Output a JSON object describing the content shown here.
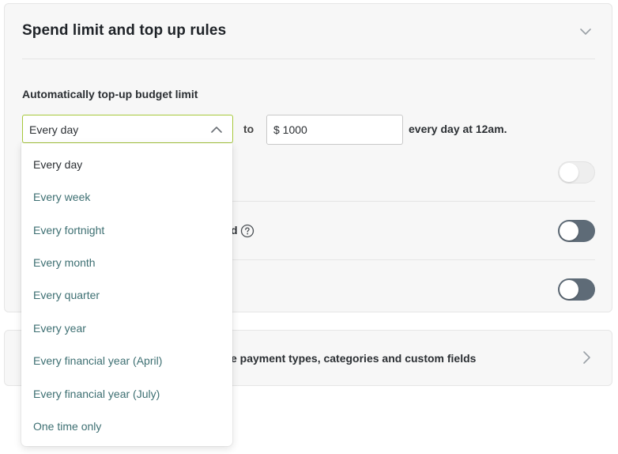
{
  "section": {
    "title": "Spend limit and top up rules",
    "expand_icon": "chevron-down-icon"
  },
  "topup": {
    "label": "Automatically top-up budget limit",
    "frequency_value": "Every day",
    "to_text": "to",
    "amount_value": "$ 1000",
    "suffix": "every day at 12am."
  },
  "frequency_options": [
    "Every day",
    "Every week",
    "Every fortnight",
    "Every month",
    "Every quarter",
    "Every year",
    "Every financial year (April)",
    "Every financial year (July)",
    "One time only"
  ],
  "rows": {
    "row2_partial_text": "d",
    "help_icon": "question-circle-icon"
  },
  "toggles": {
    "row1_state": "off",
    "row2_state": "off",
    "row3_state": "off"
  },
  "second_section": {
    "partial_text": "e payment types, categories and custom fields",
    "arrow_icon": "chevron-right-icon"
  },
  "colors": {
    "accent_border": "#a7c83b",
    "toggle_dark": "#5e6b77",
    "menu_text": "#3d6f72"
  }
}
